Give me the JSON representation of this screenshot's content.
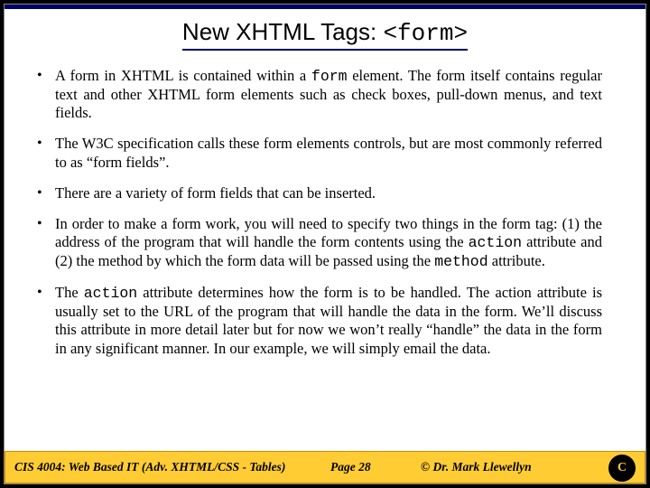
{
  "title": {
    "prefix": "New XHTML Tags: ",
    "tag": "<form>"
  },
  "bullets": {
    "b0a": "A form in XHTML is contained within a ",
    "b0b": "form",
    "b0c": " element.  The form itself contains regular text and other XHTML form elements such as check boxes, pull-down menus, and text fields.",
    "b1": "The W3C specification calls these form elements controls, but are most commonly referred to as “form fields”.",
    "b2": "There are a variety of form fields that can be inserted.",
    "b3a": "In order to make a form work, you will need to specify two things in the form tag: (1) the address of the program that will handle the form contents using the ",
    "b3b": "action",
    "b3c": " attribute and (2) the method by which the form data will be passed using the ",
    "b3d": "method",
    "b3e": " attribute.",
    "b4a": "The ",
    "b4b": "action",
    "b4c": " attribute determines how the form is to be handled.  The action attribute is usually set to the URL of the program that will handle the data in the form.  We’ll discuss this attribute in more detail later but for now we won’t really “handle” the data in the form in any significant manner.  In our example, we will simply email the data."
  },
  "footer": {
    "course": "CIS 4004: Web Based IT (Adv. XHTML/CSS - Tables)",
    "page": "Page 28",
    "author": "© Dr. Mark Llewellyn",
    "logoLetter": "C"
  }
}
